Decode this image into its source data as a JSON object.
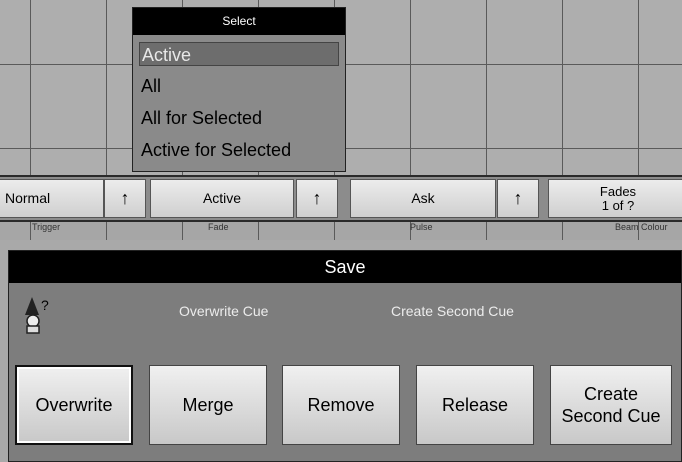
{
  "select_popup": {
    "title": "Select",
    "items": [
      "Active",
      "All",
      "All for Selected",
      "Active for Selected"
    ],
    "selected": "Active"
  },
  "bar": {
    "trigger_value": "Normal",
    "fade_value": "Active",
    "pulse_value": "Ask",
    "fades_line1": "Fades",
    "fades_line2": "1 of ?",
    "arrow_glyph": "🠉",
    "labels": [
      "Trigger",
      "Fade",
      "Pulse",
      "Beam Colour"
    ]
  },
  "save_dialog": {
    "title": "Save",
    "message_overwrite": "Overwrite Cue",
    "message_create": "Create  Second Cue",
    "buttons": {
      "overwrite": "Overwrite",
      "merge": "Merge",
      "remove": "Remove",
      "release": "Release",
      "create_line1": "Create",
      "create_line2": "Second Cue"
    }
  }
}
